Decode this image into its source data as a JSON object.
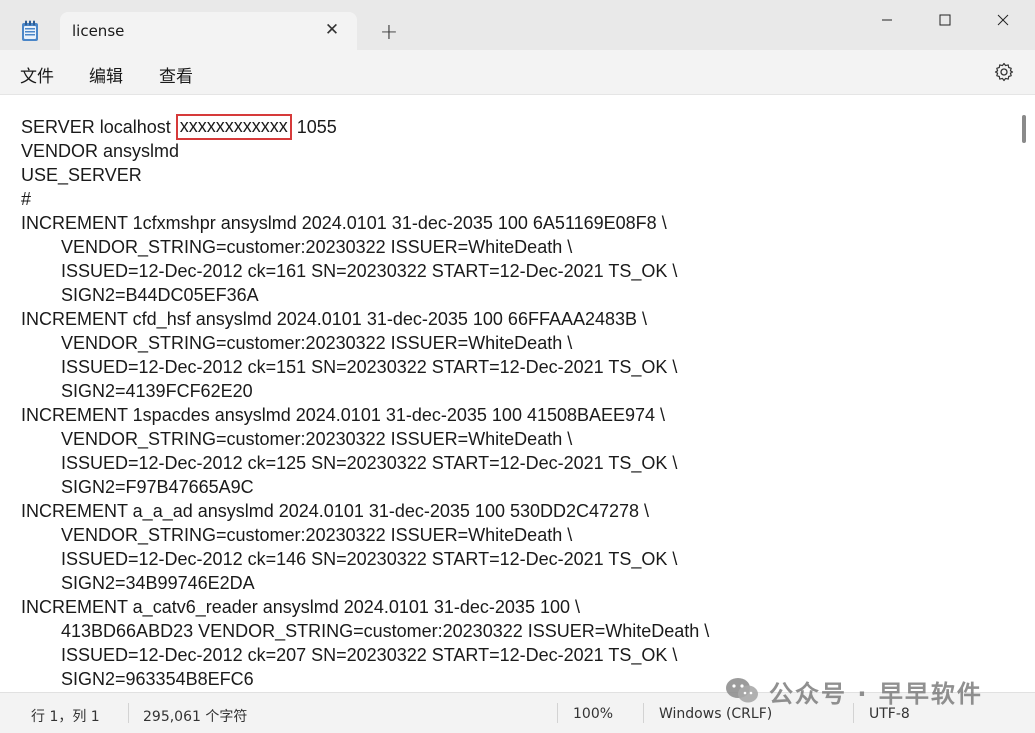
{
  "window": {
    "tab_title": "license",
    "tab_close": "✕",
    "new_tab": "+",
    "minimize": "—",
    "maximize": "☐",
    "close": "✕"
  },
  "menu": {
    "file": "文件",
    "edit": "编辑",
    "view": "查看"
  },
  "editor": {
    "lines": [
      {
        "indent": false,
        "text": "SERVER localhost "
      },
      {
        "indent": false,
        "text": "VENDOR ansyslmd"
      },
      {
        "indent": false,
        "text": "USE_SERVER"
      },
      {
        "indent": false,
        "text": "#"
      },
      {
        "indent": false,
        "text": "INCREMENT 1cfxmshpr ansyslmd 2024.0101 31-dec-2035 100 6A51169E08F8 \\"
      },
      {
        "indent": true,
        "text": "VENDOR_STRING=customer:20230322 ISSUER=WhiteDeath \\"
      },
      {
        "indent": true,
        "text": "ISSUED=12-Dec-2012 ck=161 SN=20230322 START=12-Dec-2021 TS_OK \\"
      },
      {
        "indent": true,
        "text": "SIGN2=B44DC05EF36A"
      },
      {
        "indent": false,
        "text": "INCREMENT cfd_hsf ansyslmd 2024.0101 31-dec-2035 100 66FFAAA2483B \\"
      },
      {
        "indent": true,
        "text": "VENDOR_STRING=customer:20230322 ISSUER=WhiteDeath \\"
      },
      {
        "indent": true,
        "text": "ISSUED=12-Dec-2012 ck=151 SN=20230322 START=12-Dec-2021 TS_OK \\"
      },
      {
        "indent": true,
        "text": "SIGN2=4139FCF62E20"
      },
      {
        "indent": false,
        "text": "INCREMENT 1spacdes ansyslmd 2024.0101 31-dec-2035 100 41508BAEE974 \\"
      },
      {
        "indent": true,
        "text": "VENDOR_STRING=customer:20230322 ISSUER=WhiteDeath \\"
      },
      {
        "indent": true,
        "text": "ISSUED=12-Dec-2012 ck=125 SN=20230322 START=12-Dec-2021 TS_OK \\"
      },
      {
        "indent": true,
        "text": "SIGN2=F97B47665A9C"
      },
      {
        "indent": false,
        "text": "INCREMENT a_a_ad ansyslmd 2024.0101 31-dec-2035 100 530DD2C47278 \\"
      },
      {
        "indent": true,
        "text": "VENDOR_STRING=customer:20230322 ISSUER=WhiteDeath \\"
      },
      {
        "indent": true,
        "text": "ISSUED=12-Dec-2012 ck=146 SN=20230322 START=12-Dec-2021 TS_OK \\"
      },
      {
        "indent": true,
        "text": "SIGN2=34B99746E2DA"
      },
      {
        "indent": false,
        "text": "INCREMENT a_catv6_reader ansyslmd 2024.0101 31-dec-2035 100 \\"
      },
      {
        "indent": true,
        "text": "413BD66ABD23 VENDOR_STRING=customer:20230322 ISSUER=WhiteDeath \\"
      },
      {
        "indent": true,
        "text": "ISSUED=12-Dec-2012 ck=207 SN=20230322 START=12-Dec-2021 TS_OK \\"
      },
      {
        "indent": true,
        "text": "SIGN2=963354B8EFC6"
      }
    ],
    "server_hostid": "xxxxxxxxxxxx",
    "server_port": " 1055"
  },
  "status": {
    "position": "行 1，列 1",
    "char_count": "295,061 个字符",
    "zoom": "100%",
    "line_ending": "Windows (CRLF)",
    "encoding": "UTF-8"
  },
  "watermark": {
    "text": "公众号 · 早早软件"
  },
  "colors": {
    "highlight_border": "#d63a3a",
    "titlebar_bg": "#e9e9e9",
    "editor_bg": "#ffffff"
  }
}
